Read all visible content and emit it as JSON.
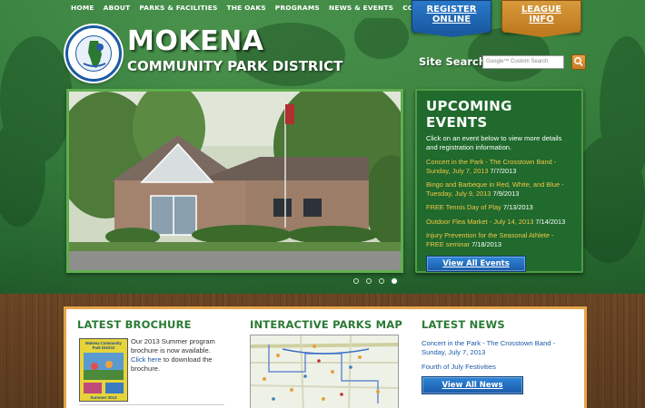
{
  "nav": {
    "items": [
      "HOME",
      "ABOUT",
      "PARKS & FACILITIES",
      "THE OAKS",
      "PROGRAMS",
      "NEWS & EVENTS",
      "CONTACT"
    ]
  },
  "tabs": {
    "register": "REGISTER ONLINE",
    "league": "LEAGUE INFO"
  },
  "logo": {
    "title": "MOKENA",
    "subtitle": "COMMUNITY PARK DISTRICT"
  },
  "search": {
    "label": "Site Search:",
    "placeholder": "Google™ Custom Search"
  },
  "events": {
    "heading": "UPCOMING EVENTS",
    "intro": "Click on an event below to view more details and registration information.",
    "items": [
      {
        "title": "Concert in the Park - The Crosstown Band - Sunday, July 7, 2013",
        "date": "7/7/2013"
      },
      {
        "title": "Bingo and Barbeque in Red, White, and Blue - Tuesday, July 9, 2013",
        "date": "7/9/2013"
      },
      {
        "title": "FREE Tennis Day of Play",
        "date": "7/13/2013"
      },
      {
        "title": "Outdoor Flea Market - July 14, 2013",
        "date": "7/14/2013"
      },
      {
        "title": "Injury Prevention for the Seasonal Athlete - FREE seminar",
        "date": "7/18/2013"
      }
    ],
    "view_all": "View All Events"
  },
  "slideshow": {
    "active_slide": 4,
    "slide_count": 4
  },
  "brochure": {
    "heading": "LATEST BROCHURE",
    "cover_title": "Mokena Community Park District",
    "cover_footer": "Summer 2013",
    "text_before": "Our 2013 Summer program brochure is now available. ",
    "link": "Click here",
    "text_after": " to download the brochure."
  },
  "map": {
    "heading": "INTERACTIVE PARKS MAP"
  },
  "news": {
    "heading": "LATEST NEWS",
    "items": [
      "Concert in the Park - The Crosstown Band - Sunday, July 7, 2013",
      "Fourth of July Festivities"
    ],
    "view_all": "View All News"
  },
  "colors": {
    "green_dark": "#1f6a2c",
    "green_accent": "#2a7a34",
    "event_link": "#f2c54a",
    "blue_button": "#1a5aa8",
    "orange_tab": "#c07a20",
    "wood": "#5a3a1e"
  }
}
